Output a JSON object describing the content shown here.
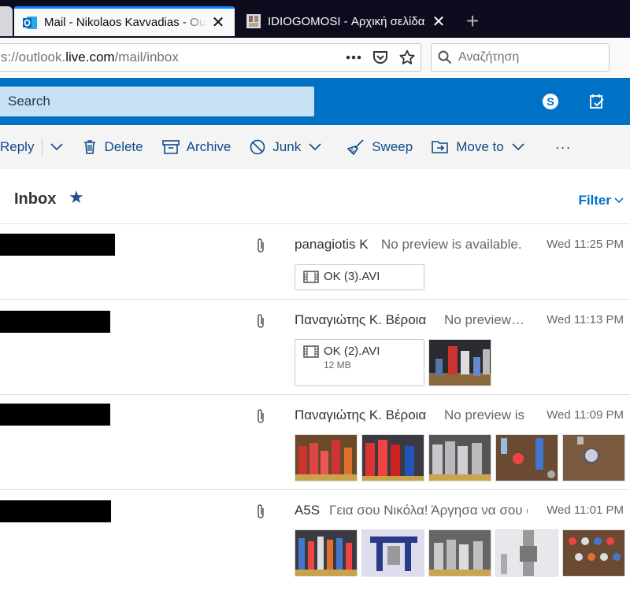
{
  "browser": {
    "tabs": [
      {
        "title": "Mail - Nikolaos Kavvadias - Outlook",
        "active": true,
        "favicon": "outlook-icon"
      },
      {
        "title": "IDIOGOMOSI - Αρχική σελίδα",
        "active": false,
        "favicon": "site-icon"
      }
    ],
    "url_prefix": "s://outlook.",
    "url_domain": "live.com",
    "url_path": "/mail/inbox",
    "search_placeholder": "Αναζήτηση"
  },
  "outlook": {
    "search_placeholder": "Search",
    "header_icons": [
      "skype-icon",
      "todo-icon"
    ],
    "accent": "#0072c6",
    "commands": {
      "reply": "Reply",
      "delete": "Delete",
      "archive": "Archive",
      "junk": "Junk",
      "sweep": "Sweep",
      "move_to": "Move to",
      "more": "···"
    },
    "folder": {
      "title": "Inbox",
      "filter": "Filter"
    }
  },
  "messages": [
    {
      "sender": "panagiotis K",
      "preview": "No preview is available.",
      "time": "Wed 11:25 PM",
      "attachment": {
        "name": "OK (3).AVI",
        "size": ""
      },
      "thumbnails": 0
    },
    {
      "sender": "Παναγιώτης Κ. Βέροια",
      "preview": "No preview is available.",
      "time": "Wed 11:13 PM",
      "attachment": {
        "name": "OK (2).AVI",
        "size": "12 MB"
      },
      "thumbnails": 1
    },
    {
      "sender": "Παναγιώτης Κ. Βέροια",
      "preview": "No preview is available.",
      "time": "Wed 11:09 PM",
      "attachment": null,
      "thumbnails": 5
    },
    {
      "sender": "A5S",
      "preview": "Γεια σου Νικόλα! Άργησα να σου απαντήσω",
      "time": "Wed 11:01 PM",
      "attachment": null,
      "thumbnails": 5
    }
  ]
}
